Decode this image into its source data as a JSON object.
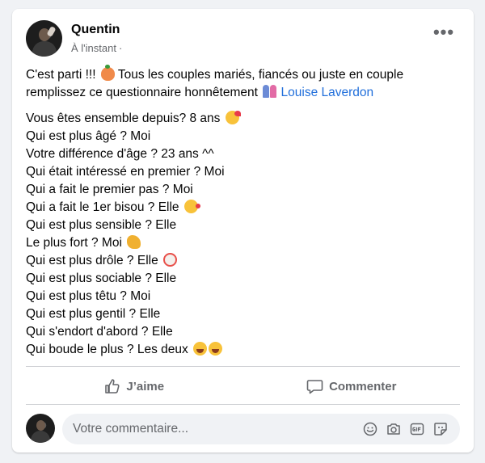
{
  "post": {
    "author": "Quentin",
    "timestamp": "À l'instant",
    "dot": "·",
    "more": "•••",
    "intro_part1": "C'est parti !!! ",
    "intro_part2": " Tous les couples mariés, fiancés ou juste en couple remplissez ce questionnaire honnêtement ",
    "mention": "Louise Laverdon",
    "lines": [
      "Vous êtes ensemble depuis? 8 ans",
      "Qui est plus âgé ? Moi",
      "Votre différence d'âge ?  23 ans ^^",
      "Qui était intéressé en premier ? Moi",
      "Qui a fait le premier pas ? Moi",
      "Qui a fait le 1er bisou ?  Elle",
      "Qui est plus sensible ? Elle",
      "Le plus fort ? Moi",
      "Qui est plus drôle ? Elle",
      "Qui est plus sociable ? Elle",
      "Qui est plus têtu ? Moi",
      "Qui est plus gentil ? Elle",
      "Qui s'endort d'abord ? Elle",
      "Qui boude le plus ? Les deux"
    ],
    "emojis": {
      "intro_1": "peach-icon",
      "intro_2": "couple-icon",
      "line_0": "smiling-face-with-hearts-icon",
      "line_5": "face-blowing-kiss-icon",
      "line_7": "flexed-biceps-icon",
      "line_8": "clown-face-icon",
      "line_13": "laughing-faces-icon"
    }
  },
  "actions": {
    "like_label": "J’aime",
    "comment_label": "Commenter"
  },
  "comment": {
    "placeholder": "Votre commentaire..."
  },
  "colors": {
    "mention": "#216fdb",
    "muted": "#65676b",
    "background": "#f0f2f5"
  }
}
